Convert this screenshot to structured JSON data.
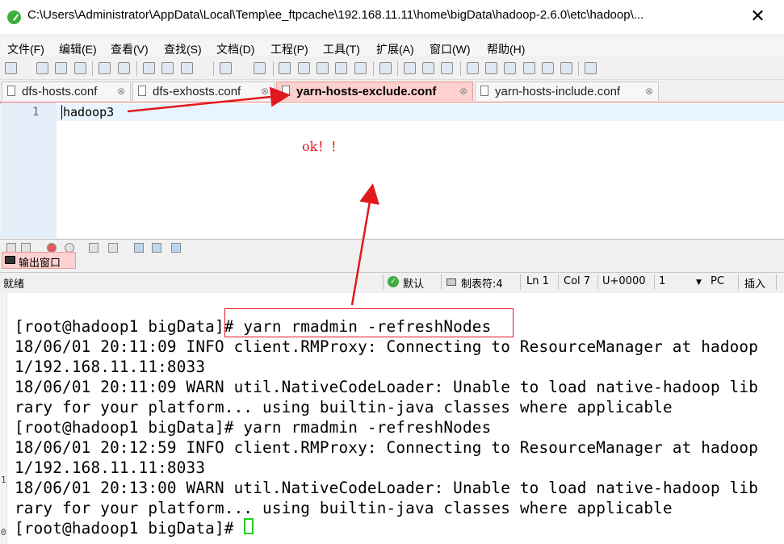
{
  "window": {
    "title": "C:\\Users\\Administrator\\AppData\\Local\\Temp\\ee_ftpcache\\192.168.11.11\\home\\bigData\\hadoop-2.6.0\\etc\\hadoop\\...",
    "close_glyph": "✕"
  },
  "menu": [
    "文件(F)",
    "编辑(E)",
    "查看(V)",
    "查找(S)",
    "文档(D)",
    "工程(P)",
    "工具(T)",
    "扩展(A)",
    "窗口(W)",
    "帮助(H)"
  ],
  "tabs": [
    {
      "label": "dfs-hosts.conf",
      "active": false
    },
    {
      "label": "dfs-exhosts.conf",
      "active": false
    },
    {
      "label": "yarn-hosts-exclude.conf",
      "active": true
    },
    {
      "label": "yarn-hosts-include.conf",
      "active": false
    }
  ],
  "tab_close_glyph": "⊗",
  "editor": {
    "line_number": "1",
    "line_text": "hadoop3",
    "annotation": "ok！！"
  },
  "output_panel": {
    "tab_label": "输出窗口"
  },
  "status": {
    "ready": "就绪",
    "encoding_mode": "默认",
    "tab_size": "制表符:4",
    "line": "Ln 1",
    "col": "Col 7",
    "unicode": "U+0000",
    "sel": "1",
    "dropdown_glyph": "▼",
    "line_ending": "PC",
    "insert_mode": "插入"
  },
  "terminal": {
    "lines": [
      "[root@hadoop1 bigData]# yarn rmadmin -refreshNodes",
      "18/06/01 20:11:09 INFO client.RMProxy: Connecting to ResourceManager at hadoop",
      "1/192.168.11.11:8033",
      "18/06/01 20:11:09 WARN util.NativeCodeLoader: Unable to load native-hadoop lib",
      "rary for your platform... using builtin-java classes where applicable",
      "[root@hadoop1 bigData]# yarn rmadmin -refreshNodes",
      "18/06/01 20:12:59 INFO client.RMProxy: Connecting to ResourceManager at hadoop",
      "1/192.168.11.11:8033",
      "18/06/01 20:13:00 WARN util.NativeCodeLoader: Unable to load native-hadoop lib",
      "rary for your platform... using builtin-java classes where applicable",
      "[root@hadoop1 bigData]# "
    ]
  },
  "colors": {
    "annotation_red": "#e0191f",
    "active_tab": "#ffd0d0",
    "cursor_green": "#22cc22"
  }
}
